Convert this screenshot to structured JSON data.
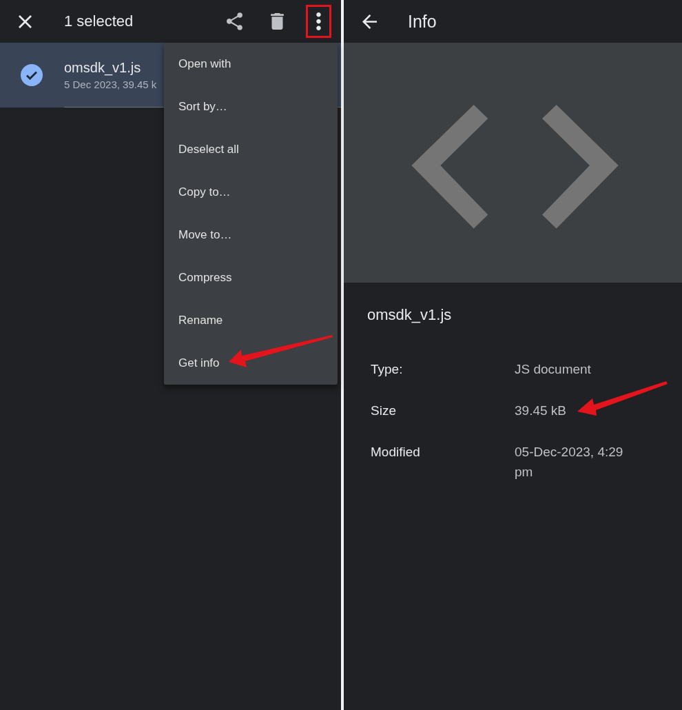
{
  "selection_toolbar": {
    "title": "1 selected"
  },
  "file_list": [
    {
      "name": "omsdk_v1.js",
      "details": "5 Dec 2023, 39.45 k",
      "selected": true
    }
  ],
  "overflow_menu": {
    "items": [
      "Open with",
      "Sort by…",
      "Deselect all",
      "Copy to…",
      "Move to…",
      "Compress",
      "Rename",
      "Get info"
    ]
  },
  "info_screen": {
    "title": "Info",
    "file_name": "omsdk_v1.js",
    "properties": [
      {
        "label": "Type:",
        "value": "JS document"
      },
      {
        "label": "Size",
        "value": "39.45 kB"
      },
      {
        "label": "Modified",
        "value": "05-Dec-2023, 4:29 pm"
      }
    ]
  }
}
